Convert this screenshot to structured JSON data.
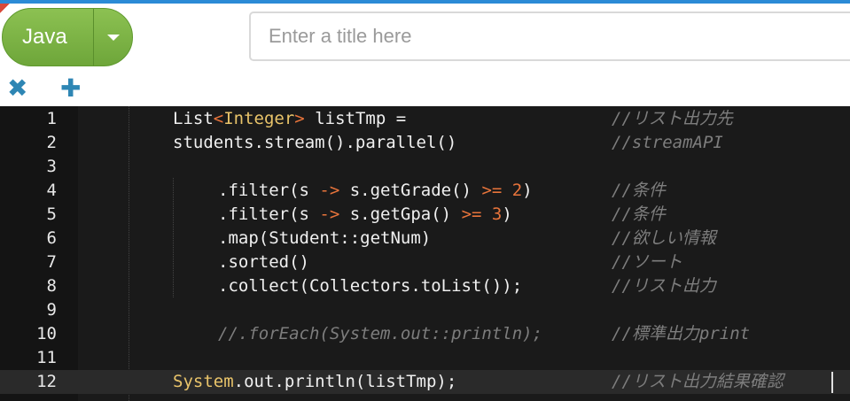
{
  "toolbar": {
    "language_label": "Java",
    "title_placeholder": "Enter a title here",
    "close_icon": "✖",
    "add_icon": "✚"
  },
  "editor": {
    "lines": [
      {
        "num": "1",
        "comment": "//リスト出力先"
      },
      {
        "num": "2",
        "code": "students.stream().parallel()",
        "comment": "//streamAPI"
      },
      {
        "num": "3"
      },
      {
        "num": "4",
        "comment": "//条件"
      },
      {
        "num": "5",
        "comment": "//条件"
      },
      {
        "num": "6",
        "code": ".map(Student::getNum)",
        "comment": "//欲しい情報"
      },
      {
        "num": "7",
        "code": ".sorted()",
        "comment": "//ソート"
      },
      {
        "num": "8",
        "code": ".collect(Collectors.toList());",
        "comment": "//リスト出力"
      },
      {
        "num": "9"
      },
      {
        "num": "10",
        "code": "//.forEach(System.out::println);",
        "comment": "//標準出力print"
      },
      {
        "num": "11"
      },
      {
        "num": "12",
        "comment": "//リスト出力結果確認"
      }
    ],
    "tokens": {
      "l1_list": "List",
      "l1_lt": "<",
      "l1_integer": "Integer",
      "l1_gt": ">",
      "l1_rest": " listTmp =",
      "l4_a": ".filter(s ",
      "l4_arrow": "->",
      "l4_b": " s.getGrade() ",
      "l4_ge": ">=",
      "l4_sp": " ",
      "l4_num": "2",
      "l4_close": ")",
      "l5_a": ".filter(s ",
      "l5_arrow": "->",
      "l5_b": " s.getGpa() ",
      "l5_ge": ">=",
      "l5_sp": " ",
      "l5_num": "3",
      "l5_close": ")",
      "l12_system": "System",
      "l12_rest": ".out.println(listTmp);"
    }
  },
  "colors": {
    "accent_green": "#7bb342",
    "editor_bg": "#1a1a1a",
    "keyword": "#e9c46a",
    "operator": "#e8743b",
    "comment": "#7d7d7d"
  }
}
